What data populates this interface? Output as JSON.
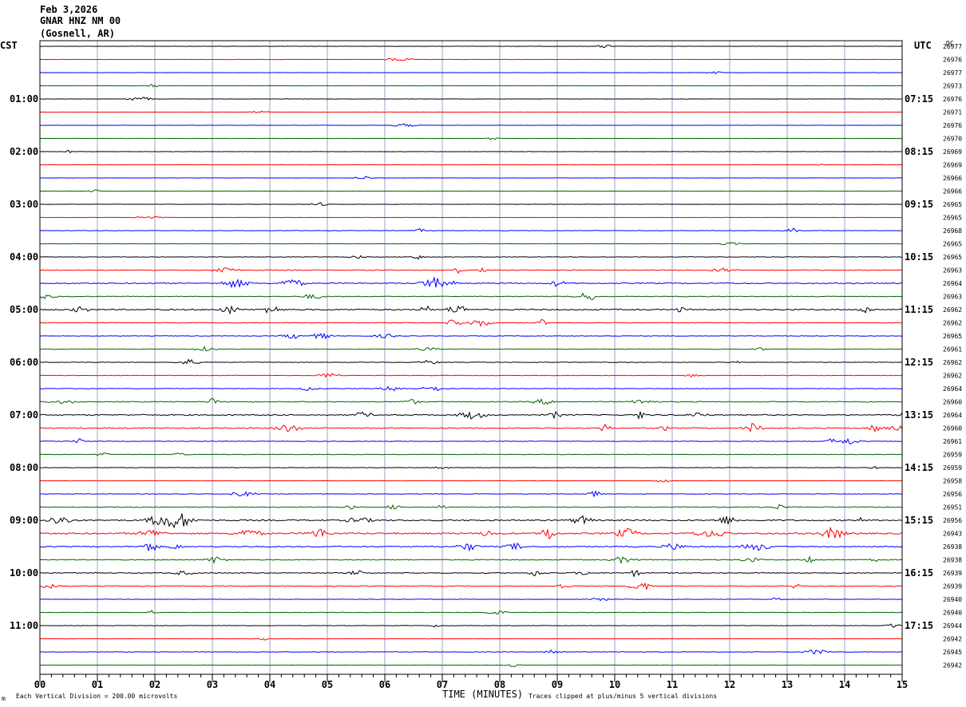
{
  "header": {
    "date": "Feb 3,2026",
    "station": "GNAR HNZ NM 00",
    "location": "(Gosnell, AR)"
  },
  "left_timezone": "CST",
  "right_timezone": "UTC",
  "dc_header": "DC",
  "footer": {
    "scale_note": "Each Vertical Division =  200.00 microvolts",
    "clip_note": "Traces clipped at plus/minus 5 vertical divisions",
    "corner_mark": "m"
  },
  "colors": {
    "trace_cycle": [
      "#000000",
      "#ff0000",
      "#0000ff",
      "#006400"
    ],
    "gridline": "#a0a0c8",
    "frame": "#000000"
  },
  "chart_data": {
    "type": "line",
    "title": "GNAR HNZ NM 00",
    "xlabel": "TIME (MINUTES)",
    "ylabel": "",
    "xlim": [
      0,
      15
    ],
    "x_ticks": [
      "00",
      "01",
      "02",
      "03",
      "04",
      "05",
      "06",
      "07",
      "08",
      "09",
      "10",
      "11",
      "12",
      "13",
      "14",
      "15"
    ],
    "grid": true,
    "rows_per_hour": 4,
    "row_count": 48,
    "left_hour_labels": [
      "01:00",
      "02:00",
      "03:00",
      "04:00",
      "05:00",
      "06:00",
      "07:00",
      "08:00",
      "09:00",
      "10:00",
      "11:00"
    ],
    "right_hour_labels": [
      "07:15",
      "08:15",
      "09:15",
      "10:15",
      "11:15",
      "12:15",
      "13:15",
      "14:15",
      "15:15",
      "16:15",
      "17:15"
    ],
    "dc_offsets": [
      "26977",
      "26976",
      "26977",
      "26973",
      "26976",
      "26971",
      "26976",
      "26970",
      "26969",
      "26969",
      "26966",
      "26966",
      "26965",
      "26965",
      "26968",
      "26965",
      "26965",
      "26963",
      "26964",
      "26963",
      "26962",
      "26962",
      "26965",
      "26961",
      "26962",
      "26962",
      "26964",
      "26960",
      "26964",
      "26960",
      "26961",
      "26959",
      "26959",
      "26958",
      "26956",
      "26951",
      "26956",
      "26943",
      "26938",
      "26938",
      "26939",
      "26939",
      "26940",
      "26940",
      "26944",
      "26942",
      "26945",
      "26942"
    ],
    "series_activity": [
      0.4,
      0.3,
      0.3,
      0.3,
      0.4,
      0.3,
      0.3,
      0.3,
      0.4,
      0.3,
      0.3,
      0.3,
      0.4,
      0.3,
      0.5,
      0.3,
      0.7,
      1.2,
      1.6,
      1.0,
      1.8,
      1.0,
      0.8,
      0.9,
      0.8,
      0.6,
      0.8,
      1.3,
      1.6,
      1.5,
      0.8,
      0.7,
      0.6,
      0.4,
      0.7,
      1.2,
      2.0,
      2.3,
      1.6,
      1.3,
      1.3,
      1.2,
      0.6,
      0.6,
      0.5,
      0.4,
      0.7,
      0.4
    ]
  }
}
